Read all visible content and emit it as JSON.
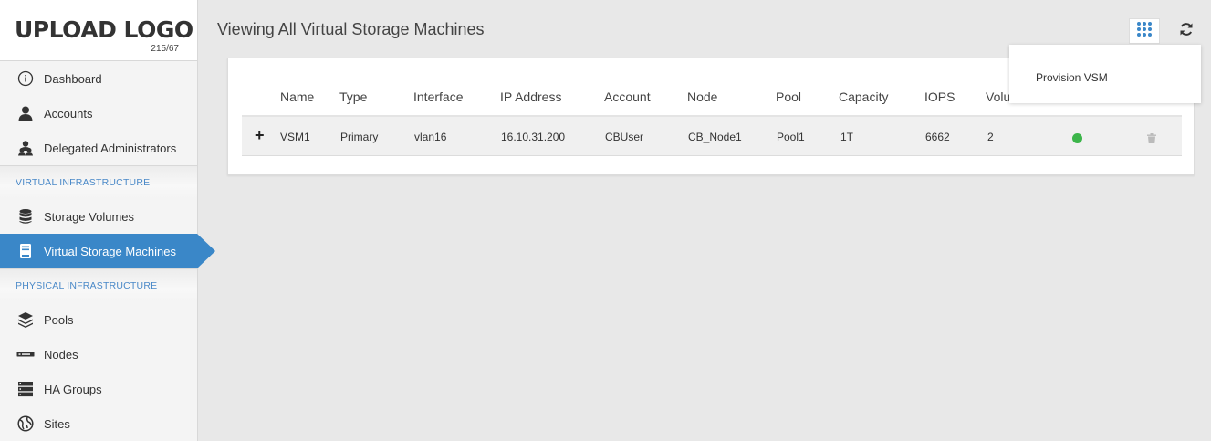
{
  "logo": {
    "text": "UPLOAD LOGO",
    "version": "215/67"
  },
  "sidebar": {
    "items_top": [
      {
        "label": "Dashboard",
        "icon": "info-icon"
      },
      {
        "label": "Accounts",
        "icon": "user-icon"
      },
      {
        "label": "Delegated Administrators",
        "icon": "users-icon"
      }
    ],
    "section_virtual": "VIRTUAL INFRASTRUCTURE",
    "items_virtual": [
      {
        "label": "Storage Volumes",
        "icon": "database-icon"
      },
      {
        "label": "Virtual Storage Machines",
        "icon": "server-icon",
        "active": true
      }
    ],
    "section_physical": "PHYSICAL INFRASTRUCTURE",
    "items_physical": [
      {
        "label": "Pools",
        "icon": "layers-icon"
      },
      {
        "label": "Nodes",
        "icon": "node-icon"
      },
      {
        "label": "HA Groups",
        "icon": "stack-icon"
      },
      {
        "label": "Sites",
        "icon": "globe-icon"
      }
    ]
  },
  "page": {
    "title": "Viewing All Virtual Storage Machines"
  },
  "toolbar": {
    "grid_icon": "grid-icon",
    "refresh_icon": "refresh-icon"
  },
  "dropdown": {
    "items": [
      "Provision VSM"
    ]
  },
  "table": {
    "columns": [
      "Name",
      "Type",
      "Interface",
      "IP Address",
      "Account",
      "Node",
      "Pool",
      "Capacity",
      "IOPS",
      "Volu"
    ],
    "rows": [
      {
        "name": "VSM1",
        "type": "Primary",
        "interface": "vlan16",
        "ip": "16.10.31.200",
        "account": "CBUser",
        "node": "CB_Node1",
        "pool": "Pool1",
        "capacity": "1T",
        "iops": "6662",
        "volumes": "2",
        "status": "online",
        "expand_glyph": "+"
      }
    ]
  },
  "colors": {
    "accent": "#3a87c8",
    "status_online": "#3cb54a",
    "section_header": "#4a89c8"
  }
}
